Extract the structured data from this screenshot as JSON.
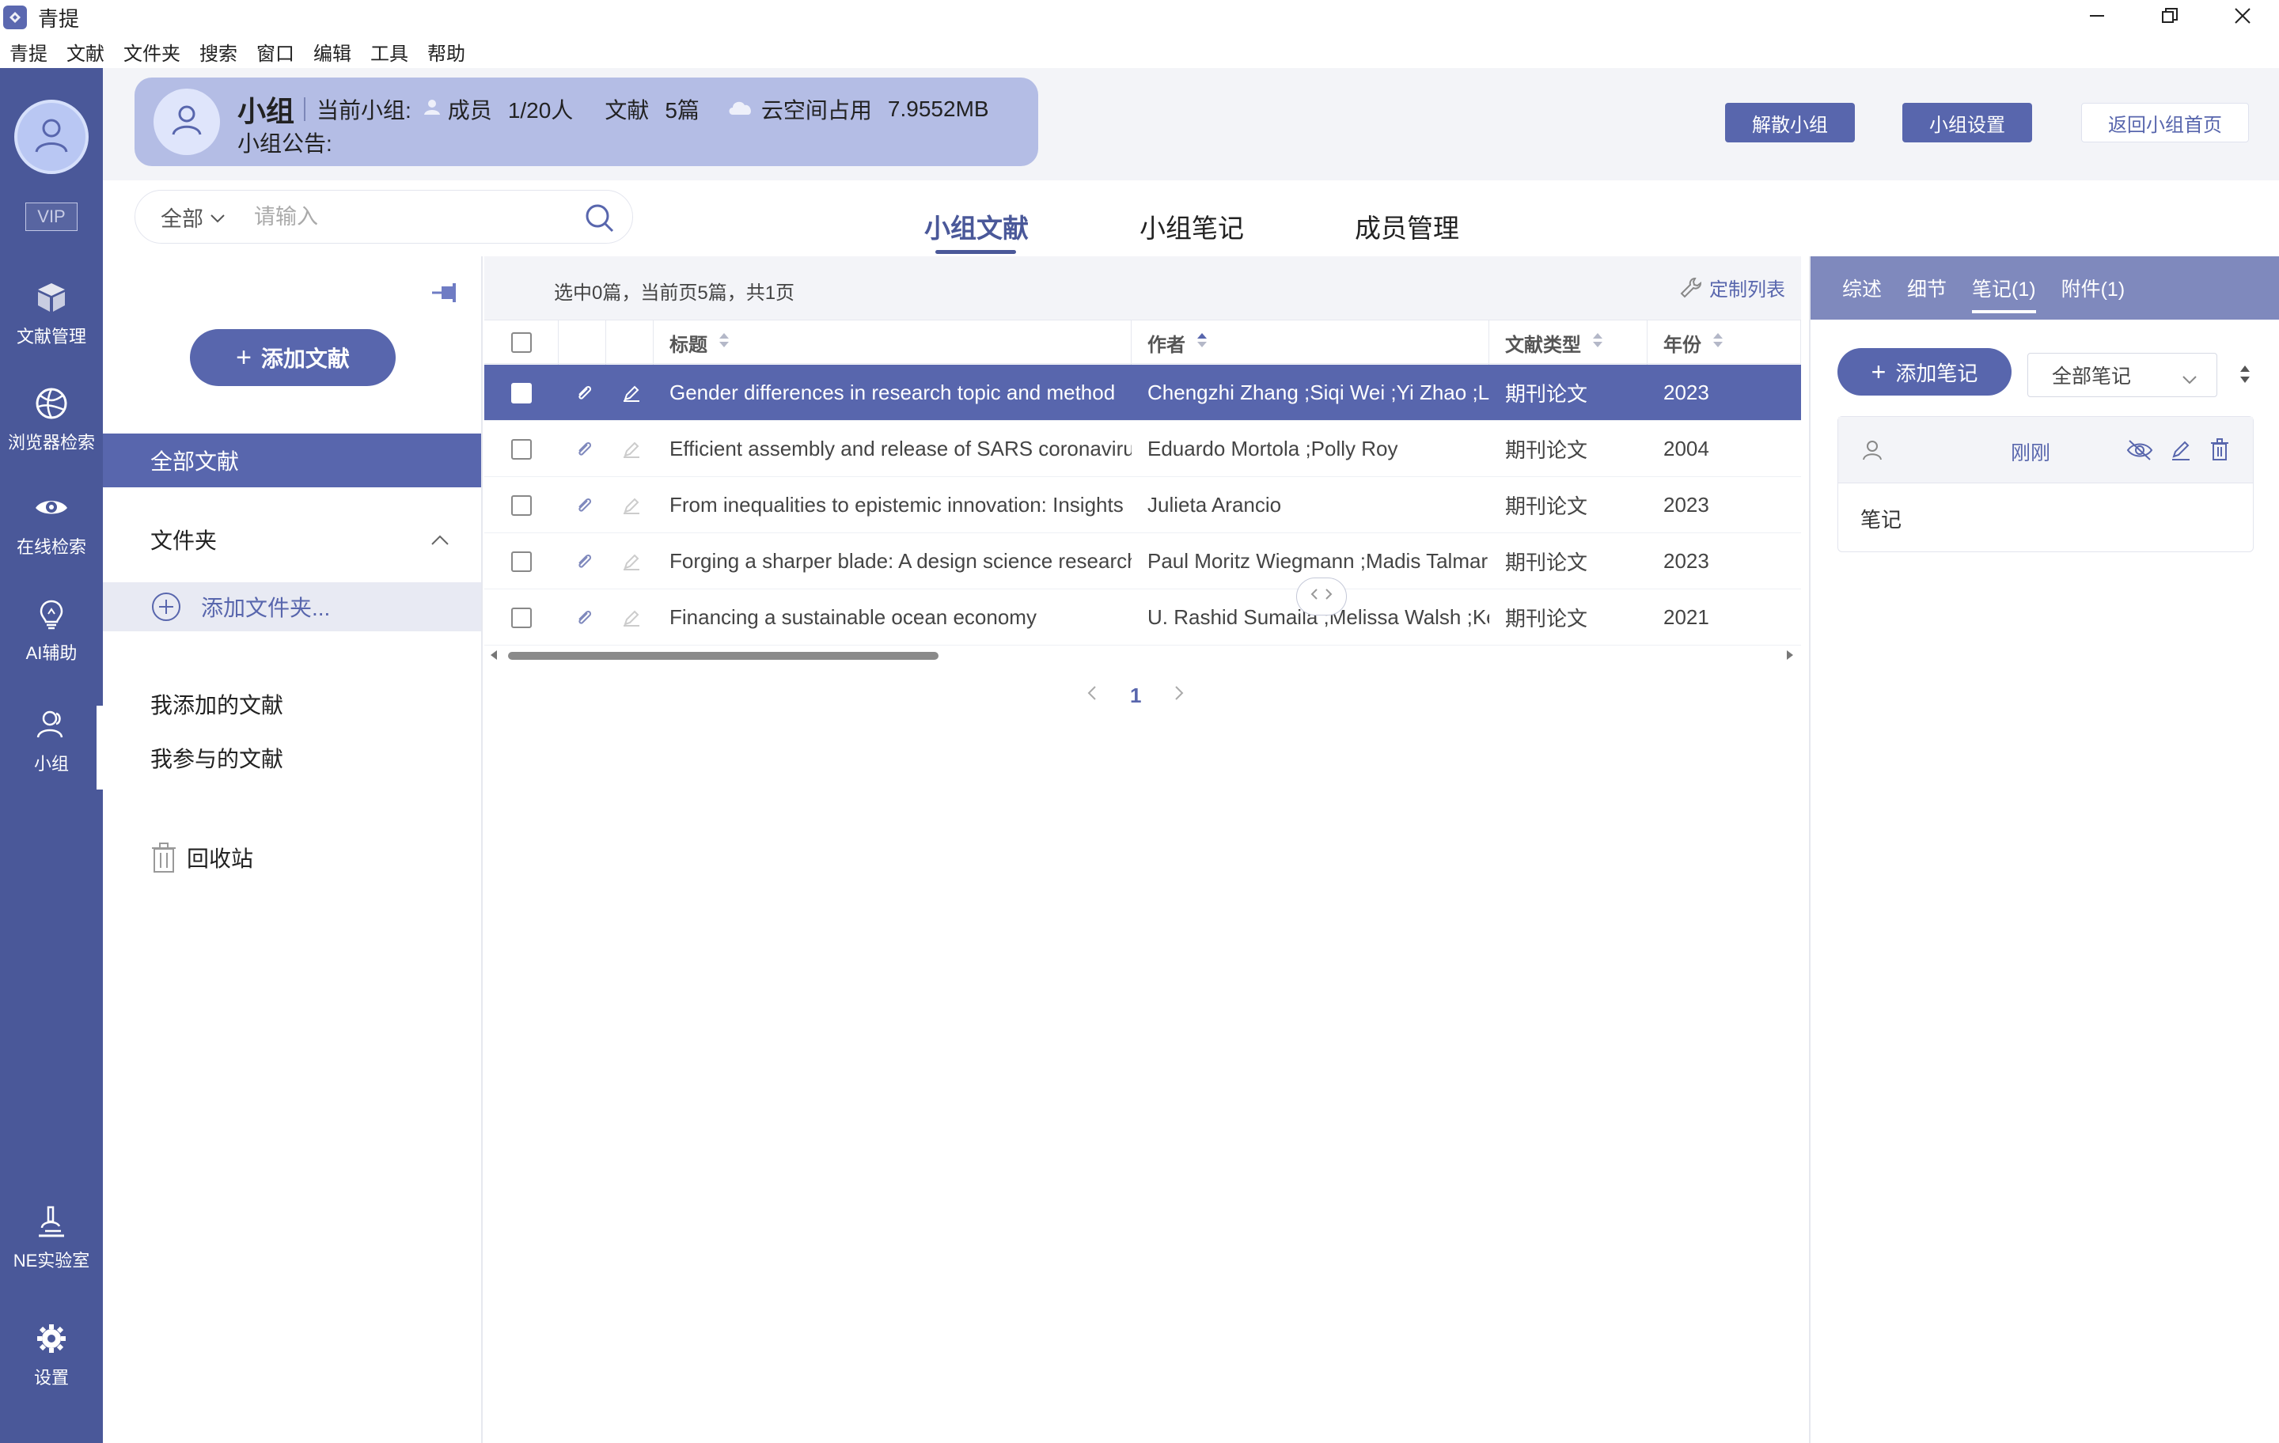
{
  "window": {
    "title": "青提",
    "controls": [
      "minimize-icon",
      "restore-icon",
      "close-icon"
    ]
  },
  "menubar": [
    "青提",
    "文献",
    "文件夹",
    "搜索",
    "窗口",
    "编辑",
    "工具",
    "帮助"
  ],
  "leftnav": {
    "vip": "VIP",
    "items": [
      {
        "label": "文献管理",
        "icon": "cube-icon"
      },
      {
        "label": "浏览器检索",
        "icon": "basketball-icon"
      },
      {
        "label": "在线检索",
        "icon": "eye-icon"
      },
      {
        "label": "AI辅助",
        "icon": "lightbulb-icon"
      },
      {
        "label": "小组",
        "icon": "group-user-icon",
        "active": true
      },
      {
        "label": "NE实验室",
        "icon": "microscope-icon"
      },
      {
        "label": "设置",
        "icon": "gear-icon"
      }
    ]
  },
  "group": {
    "name": "小组",
    "current_label": "当前小组:",
    "members_label": "成员",
    "members_value": "1/20人",
    "docs_label": "文献",
    "docs_value": "5篇",
    "cloud_label": "云空间占用",
    "cloud_value": "7.9552MB",
    "notice_label": "小组公告:"
  },
  "header_buttons": {
    "dissolve": "解散小组",
    "settings": "小组设置",
    "back_home": "返回小组首页"
  },
  "search": {
    "scope": "全部",
    "placeholder": "请输入"
  },
  "main_tabs": [
    {
      "label": "小组文献",
      "active": true
    },
    {
      "label": "小组笔记",
      "active": false
    },
    {
      "label": "成员管理",
      "active": false
    }
  ],
  "folder_panel": {
    "add_literature": "添加文献",
    "all_literature": "全部文献",
    "folders": "文件夹",
    "add_folder": "添加文件夹...",
    "my_added": "我添加的文献",
    "my_involved": "我参与的文献",
    "recycle_bin": "回收站"
  },
  "list": {
    "selection_info": "选中0篇，当前页5篇，共1页",
    "customize": "定制列表",
    "columns": [
      "标题",
      "作者",
      "文献类型",
      "年份"
    ],
    "rows": [
      {
        "title": "Gender differences in research topic and method",
        "author": "Chengzhi Zhang ;Siqi Wei ;Yi Zhao ;Lia",
        "type": "期刊论文",
        "year": "2023",
        "selected": true
      },
      {
        "title": "Efficient assembly and release of SARS coronaviru",
        "author": "Eduardo Mortola ;Polly Roy",
        "type": "期刊论文",
        "year": "2004",
        "selected": false
      },
      {
        "title": "From inequalities to epistemic innovation: Insights",
        "author": "Julieta Arancio",
        "type": "期刊论文",
        "year": "2023",
        "selected": false
      },
      {
        "title": "Forging a sharper blade: A design science research",
        "author": "Paul Moritz Wiegmann ;Madis Talmar",
        "type": "期刊论文",
        "year": "2023",
        "selected": false
      },
      {
        "title": "Financing a sustainable ocean economy",
        "author": "U. Rashid Sumaila ;Melissa Walsh ;Kell",
        "type": "期刊论文",
        "year": "2021",
        "selected": false
      }
    ],
    "page": "1"
  },
  "detail": {
    "tabs": [
      {
        "label": "综述",
        "active": false
      },
      {
        "label": "细节",
        "active": false
      },
      {
        "label": "笔记(1)",
        "active": true
      },
      {
        "label": "附件(1)",
        "active": false
      }
    ],
    "add_note": "添加笔记",
    "note_filter": "全部笔记",
    "note": {
      "time": "刚刚",
      "content": "笔记"
    }
  },
  "colors": {
    "nav_bg": "#4a5899",
    "accent": "#5866ad",
    "group_card": "#b4bde5",
    "detail_tabs_bg": "#7f89bd"
  }
}
